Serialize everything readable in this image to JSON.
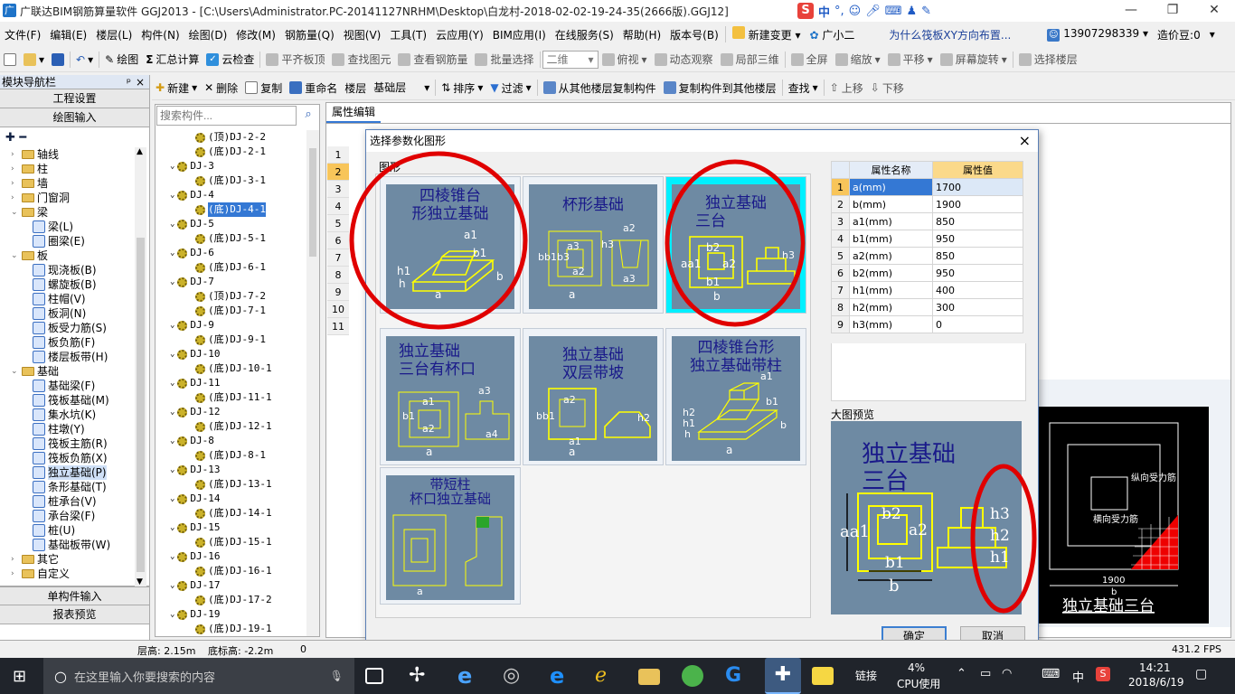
{
  "window": {
    "title": "广联达BIM钢筋算量软件 GGJ2013 - [C:\\Users\\Administrator.PC-20141127NRHM\\Desktop\\白龙村-2018-02-02-19-24-35(2666版).GGJ12]",
    "controls": {
      "minimize": "—",
      "restore": "❐",
      "close": "✕"
    }
  },
  "ime": {
    "label": "中",
    "punct": "°,"
  },
  "menu": [
    "文件(F)",
    "编辑(E)",
    "楼层(L)",
    "构件(N)",
    "绘图(D)",
    "修改(M)",
    "钢筋量(Q)",
    "视图(V)",
    "工具(T)",
    "云应用(Y)",
    "BIM应用(I)",
    "在线服务(S)",
    "帮助(H)",
    "版本号(B)"
  ],
  "menu_extra": {
    "new_change": "新建变更",
    "assistant": "广小二",
    "question": "为什么筏板XY方向布置...",
    "phone": "13907298339",
    "beans": "造价豆:0"
  },
  "toolbar1": {
    "draw": "绘图",
    "sum": "汇总计算",
    "cloud_check": "云检查",
    "flat_top": "平齐板顶",
    "find_elem": "查找图元",
    "view_rebar": "查看钢筋量",
    "batch_select": "批量选择",
    "view_mode": "二维",
    "top_view": "俯视",
    "dynamic": "动态观察",
    "local_3d": "局部三维",
    "full_screen": "全屏",
    "zoom": "缩放",
    "pan": "平移",
    "screen_rotate": "屏幕旋转",
    "select_floor": "选择楼层"
  },
  "toolbar2": {
    "new": "新建",
    "delete": "删除",
    "copy": "复制",
    "rename": "重命名",
    "floor_label": "楼层",
    "floor_value": "基础层",
    "sort": "排序",
    "filter": "过滤",
    "copy_from": "从其他楼层复制构件",
    "copy_to": "复制构件到其他楼层",
    "find": "查找",
    "move_up": "上移",
    "move_down": "下移"
  },
  "nav": {
    "header": "模块导航栏",
    "pin": "ᵖ",
    "close": "×",
    "project_settings": "工程设置",
    "drawing_input": "绘图输入",
    "single_input": "单构件输入",
    "report_preview": "报表预览",
    "items": [
      {
        "label": "轴线",
        "type": "folder"
      },
      {
        "label": "柱",
        "type": "folder"
      },
      {
        "label": "墙",
        "type": "folder"
      },
      {
        "label": "门窗洞",
        "type": "folder"
      },
      {
        "label": "梁",
        "type": "folder-open"
      },
      {
        "label": "梁(L)",
        "type": "leaf"
      },
      {
        "label": "圈梁(E)",
        "type": "leaf"
      },
      {
        "label": "板",
        "type": "folder-open"
      },
      {
        "label": "现浇板(B)",
        "type": "leaf"
      },
      {
        "label": "螺旋板(B)",
        "type": "leaf"
      },
      {
        "label": "柱帽(V)",
        "type": "leaf"
      },
      {
        "label": "板洞(N)",
        "type": "leaf"
      },
      {
        "label": "板受力筋(S)",
        "type": "leaf"
      },
      {
        "label": "板负筋(F)",
        "type": "leaf"
      },
      {
        "label": "楼层板带(H)",
        "type": "leaf"
      },
      {
        "label": "基础",
        "type": "folder-open"
      },
      {
        "label": "基础梁(F)",
        "type": "leaf"
      },
      {
        "label": "筏板基础(M)",
        "type": "leaf"
      },
      {
        "label": "集水坑(K)",
        "type": "leaf"
      },
      {
        "label": "柱墩(Y)",
        "type": "leaf"
      },
      {
        "label": "筏板主筋(R)",
        "type": "leaf"
      },
      {
        "label": "筏板负筋(X)",
        "type": "leaf"
      },
      {
        "label": "独立基础(P)",
        "type": "leaf"
      },
      {
        "label": "条形基础(T)",
        "type": "leaf"
      },
      {
        "label": "桩承台(V)",
        "type": "leaf"
      },
      {
        "label": "承台梁(F)",
        "type": "leaf"
      },
      {
        "label": "桩(U)",
        "type": "leaf"
      },
      {
        "label": "基础板带(W)",
        "type": "leaf"
      },
      {
        "label": "其它",
        "type": "folder"
      },
      {
        "label": "自定义",
        "type": "folder"
      }
    ]
  },
  "components": {
    "search_placeholder": "搜索构件...",
    "items": [
      "(顶)DJ-2-2",
      "(底)DJ-2-1",
      "DJ-3",
      "(底)DJ-3-1",
      "DJ-4",
      "(底)DJ-4-1",
      "DJ-5",
      "(底)DJ-5-1",
      "DJ-6",
      "(底)DJ-6-1",
      "DJ-7",
      "(顶)DJ-7-2",
      "(底)DJ-7-1",
      "DJ-9",
      "(底)DJ-9-1",
      "DJ-10",
      "(底)DJ-10-1",
      "DJ-11",
      "(底)DJ-11-1",
      "DJ-12",
      "(底)DJ-12-1",
      "DJ-8",
      "(底)DJ-8-1",
      "DJ-13",
      "(底)DJ-13-1",
      "DJ-14",
      "(底)DJ-14-1",
      "DJ-15",
      "(底)DJ-15-1",
      "DJ-16",
      "(底)DJ-16-1",
      "DJ-17",
      "(底)DJ-17-2",
      "DJ-19",
      "(底)DJ-19-1"
    ]
  },
  "property_tab": "属性编辑",
  "row_numbers": [
    "1",
    "2",
    "3",
    "4",
    "5",
    "6",
    "7",
    "8",
    "9",
    "10",
    "11"
  ],
  "dialog": {
    "title": "选择参数化图形",
    "close": "×",
    "group_label": "图形",
    "shapes": [
      {
        "line1": "四棱锥台",
        "line2": "形独立基础"
      },
      {
        "line1": "杯形基础",
        "line2": ""
      },
      {
        "line1": "独立基础",
        "line2": "三台"
      },
      {
        "line1": "独立基础",
        "line2": "三台有杯口"
      },
      {
        "line1": "独立基础",
        "line2": "双层带坡"
      },
      {
        "line1": "四棱锥台形",
        "line2": "独立基础带柱"
      },
      {
        "line1": "带短柱",
        "line2": "杯口独立基础"
      }
    ],
    "table_head": {
      "name": "属性名称",
      "value": "属性值"
    },
    "params": [
      {
        "no": "1",
        "name": "a(mm)",
        "value": "1700"
      },
      {
        "no": "2",
        "name": "b(mm)",
        "value": "1900"
      },
      {
        "no": "3",
        "name": "a1(mm)",
        "value": "850"
      },
      {
        "no": "4",
        "name": "b1(mm)",
        "value": "950"
      },
      {
        "no": "5",
        "name": "a2(mm)",
        "value": "850"
      },
      {
        "no": "6",
        "name": "b2(mm)",
        "value": "950"
      },
      {
        "no": "7",
        "name": "h1(mm)",
        "value": "400"
      },
      {
        "no": "8",
        "name": "h2(mm)",
        "value": "300"
      },
      {
        "no": "9",
        "name": "h3(mm)",
        "value": "0"
      }
    ],
    "preview_label": "大图预览",
    "preview_title1": "独立基础",
    "preview_title2": "三台",
    "ok": "确定",
    "cancel": "取消"
  },
  "cad": {
    "longitudinal": "纵向受力筋",
    "transverse": "横向受力筋",
    "dim": "1900",
    "dim_b": "b",
    "caption": "独立基础三台"
  },
  "status": {
    "floor_height": "层高: 2.15m",
    "bottom_height": "底标高: -2.2m",
    "zero": "0",
    "fps": "431.2 FPS"
  },
  "taskbar": {
    "search_placeholder": "在这里输入你要搜索的内容",
    "link": "链接",
    "cpu_percent": "4%",
    "cpu_label": "CPU使用",
    "ime": "中",
    "time": "14:21",
    "date": "2018/6/19"
  },
  "colors": {
    "accent": "#3478d4",
    "dialog_card_bg": "#6e8aa3",
    "highlight_card": "#00f0ff",
    "annotation_circle": "#e00000"
  }
}
